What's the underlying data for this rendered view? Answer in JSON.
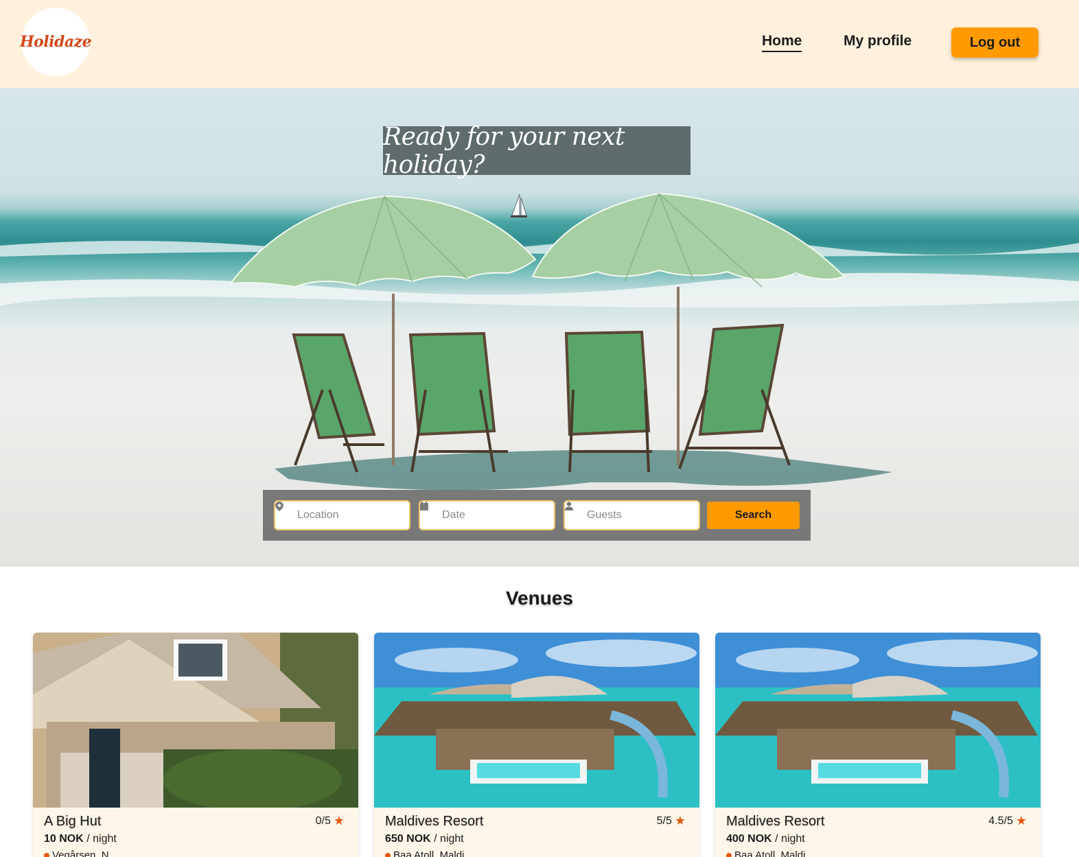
{
  "header": {
    "logo_text": "Holidaze",
    "nav": {
      "home": "Home",
      "profile": "My profile",
      "logout": "Log out"
    }
  },
  "hero": {
    "title": "Ready for your next holiday?",
    "search": {
      "location_placeholder": "Location",
      "date_placeholder": "Date",
      "guests_placeholder": "Guests",
      "button": "Search"
    }
  },
  "venues": {
    "title": "Venues",
    "items": [
      {
        "name": "A Big Hut",
        "rating": "0/5",
        "price": "10 NOK",
        "per": " / night",
        "location": "Vegårsen, N...",
        "image": "house-photo"
      },
      {
        "name": "Maldives Resort",
        "rating": "5/5",
        "price": "650 NOK",
        "per": " / night",
        "location": "Baa Atoll, Maldi...",
        "image": "resort-photo"
      },
      {
        "name": "Maldives Resort",
        "rating": "4.5/5",
        "price": "400 NOK",
        "per": " / night",
        "location": "Baa Atoll, Maldi...",
        "image": "resort-photo"
      }
    ]
  },
  "colors": {
    "accent": "#ff9a00",
    "header_bg": "#fff1dc",
    "logo": "#d2491a",
    "star": "#e55a10"
  },
  "icons": {
    "location": "map-pin-icon",
    "date": "calendar-icon",
    "guests": "user-icon",
    "rating": "star-icon"
  }
}
